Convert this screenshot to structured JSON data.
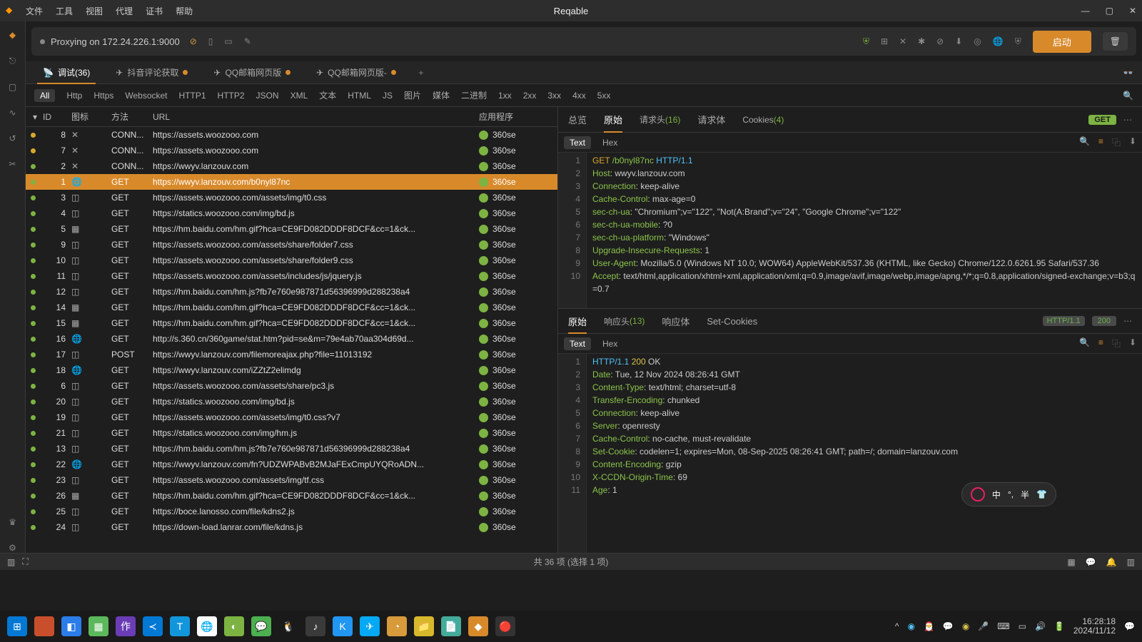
{
  "app": {
    "title": "Reqable"
  },
  "menu": [
    "文件",
    "工具",
    "视图",
    "代理",
    "证书",
    "帮助"
  ],
  "toolbar": {
    "proxying": "Proxying on 172.24.226.1:9000",
    "launch": "启动"
  },
  "capture_tabs": [
    {
      "icon": "antenna",
      "label": "调试(36)",
      "active": true
    },
    {
      "icon": "send",
      "label": "抖音评论获取",
      "modified": true
    },
    {
      "icon": "send",
      "label": "QQ邮箱网页版",
      "modified": true
    },
    {
      "icon": "send",
      "label": "QQ邮箱网页版-",
      "modified": true
    }
  ],
  "filters": [
    "All",
    "Http",
    "Https",
    "Websocket",
    "HTTP1",
    "HTTP2",
    "JSON",
    "XML",
    "文本",
    "HTML",
    "JS",
    "图片",
    "媒体",
    "二进制",
    "1xx",
    "2xx",
    "3xx",
    "4xx",
    "5xx"
  ],
  "columns": {
    "id": "ID",
    "icon": "图标",
    "method": "方法",
    "url": "URL",
    "app": "应用程序"
  },
  "rows": [
    {
      "s": "y",
      "id": 8,
      "i": "x",
      "m": "CONN...",
      "u": "https://assets.woozooo.com",
      "a": "360se"
    },
    {
      "s": "y",
      "id": 7,
      "i": "x",
      "m": "CONN...",
      "u": "https://assets.woozooo.com",
      "a": "360se"
    },
    {
      "s": "g",
      "id": 2,
      "i": "x",
      "m": "CONN...",
      "u": "https://wwyv.lanzouv.com",
      "a": "360se"
    },
    {
      "s": "g",
      "id": 1,
      "i": "globe",
      "m": "GET",
      "u": "https://wwyv.lanzouv.com/b0nyl87nc",
      "a": "360se",
      "sel": true
    },
    {
      "s": "g",
      "id": 3,
      "i": "file",
      "m": "GET",
      "u": "https://assets.woozooo.com/assets/img/t0.css",
      "a": "360se"
    },
    {
      "s": "g",
      "id": 4,
      "i": "file",
      "m": "GET",
      "u": "https://statics.woozooo.com/img/bd.js",
      "a": "360se"
    },
    {
      "s": "g",
      "id": 5,
      "i": "img",
      "m": "GET",
      "u": "https://hm.baidu.com/hm.gif?hca=CE9FD082DDDF8DCF&cc=1&ck...",
      "a": "360se"
    },
    {
      "s": "g",
      "id": 9,
      "i": "file",
      "m": "GET",
      "u": "https://assets.woozooo.com/assets/share/folder7.css",
      "a": "360se"
    },
    {
      "s": "g",
      "id": 10,
      "i": "file",
      "m": "GET",
      "u": "https://assets.woozooo.com/assets/share/folder9.css",
      "a": "360se"
    },
    {
      "s": "g",
      "id": 11,
      "i": "file",
      "m": "GET",
      "u": "https://assets.woozooo.com/assets/includes/js/jquery.js",
      "a": "360se"
    },
    {
      "s": "g",
      "id": 12,
      "i": "file",
      "m": "GET",
      "u": "https://hm.baidu.com/hm.js?fb7e760e987871d56396999d288238a4",
      "a": "360se"
    },
    {
      "s": "g",
      "id": 14,
      "i": "img",
      "m": "GET",
      "u": "https://hm.baidu.com/hm.gif?hca=CE9FD082DDDF8DCF&cc=1&ck...",
      "a": "360se"
    },
    {
      "s": "g",
      "id": 15,
      "i": "img",
      "m": "GET",
      "u": "https://hm.baidu.com/hm.gif?hca=CE9FD082DDDF8DCF&cc=1&ck...",
      "a": "360se"
    },
    {
      "s": "g",
      "id": 16,
      "i": "globe",
      "m": "GET",
      "u": "http://s.360.cn/360game/stat.htm?pid=se&m=79e4ab70aa304d69d...",
      "a": "360se"
    },
    {
      "s": "g",
      "id": 17,
      "i": "file",
      "m": "POST",
      "u": "https://wwyv.lanzouv.com/filemoreajax.php?file=11013192",
      "a": "360se"
    },
    {
      "s": "g",
      "id": 18,
      "i": "globe",
      "m": "GET",
      "u": "https://wwyv.lanzouv.com/iZZtZ2elimdg",
      "a": "360se"
    },
    {
      "s": "g",
      "id": 6,
      "i": "file",
      "m": "GET",
      "u": "https://assets.woozooo.com/assets/share/pc3.js",
      "a": "360se"
    },
    {
      "s": "g",
      "id": 20,
      "i": "file",
      "m": "GET",
      "u": "https://statics.woozooo.com/img/bd.js",
      "a": "360se"
    },
    {
      "s": "g",
      "id": 19,
      "i": "file",
      "m": "GET",
      "u": "https://assets.woozooo.com/assets/img/t0.css?v7",
      "a": "360se"
    },
    {
      "s": "g",
      "id": 21,
      "i": "file",
      "m": "GET",
      "u": "https://statics.woozooo.com/img/hm.js",
      "a": "360se"
    },
    {
      "s": "g",
      "id": 13,
      "i": "file",
      "m": "GET",
      "u": "https://hm.baidu.com/hm.js?fb7e760e987871d56396999d288238a4",
      "a": "360se"
    },
    {
      "s": "g",
      "id": 22,
      "i": "globe",
      "m": "GET",
      "u": "https://wwyv.lanzouv.com/fn?UDZWPABvB2MJaFExCmpUYQRoADN...",
      "a": "360se"
    },
    {
      "s": "g",
      "id": 23,
      "i": "file",
      "m": "GET",
      "u": "https://assets.woozooo.com/assets/img/tf.css",
      "a": "360se"
    },
    {
      "s": "g",
      "id": 26,
      "i": "img",
      "m": "GET",
      "u": "https://hm.baidu.com/hm.gif?hca=CE9FD082DDDF8DCF&cc=1&ck...",
      "a": "360se"
    },
    {
      "s": "g",
      "id": 25,
      "i": "file",
      "m": "GET",
      "u": "https://boce.lanosso.com/file/kdns2.js",
      "a": "360se"
    },
    {
      "s": "g",
      "id": 24,
      "i": "file",
      "m": "GET",
      "u": "https://down-load.lanrar.com/file/kdns.js",
      "a": "360se"
    }
  ],
  "detail": {
    "tabs": {
      "overview": "总览",
      "raw": "原始",
      "req_headers": "请求头",
      "req_hc": "(16)",
      "req_body": "请求体",
      "cookies": "Cookies",
      "cookies_c": "(4)"
    },
    "method_badge": "GET",
    "subtabs": {
      "text": "Text",
      "hex": "Hex"
    },
    "req_lines": [
      [
        {
          "t": "GET ",
          "c": "orange"
        },
        {
          "t": "/b0nyl87nc ",
          "c": "green"
        },
        {
          "t": "HTTP/1.1",
          "c": "blue"
        }
      ],
      [
        {
          "t": "Host",
          "c": "green"
        },
        {
          "t": ": wwyv.lanzouv.com",
          "c": ""
        }
      ],
      [
        {
          "t": "Connection",
          "c": "green"
        },
        {
          "t": ": keep-alive",
          "c": ""
        }
      ],
      [
        {
          "t": "Cache-Control",
          "c": "green"
        },
        {
          "t": ": max-age=0",
          "c": ""
        }
      ],
      [
        {
          "t": "sec-ch-ua",
          "c": "green"
        },
        {
          "t": ": \"Chromium\";v=\"122\", \"Not(A:Brand\";v=\"24\", \"Google Chrome\";v=\"122\"",
          "c": ""
        }
      ],
      [
        {
          "t": "sec-ch-ua-mobile",
          "c": "green"
        },
        {
          "t": ": ?0",
          "c": ""
        }
      ],
      [
        {
          "t": "sec-ch-ua-platform",
          "c": "green"
        },
        {
          "t": ": \"Windows\"",
          "c": ""
        }
      ],
      [
        {
          "t": "Upgrade-Insecure-Requests",
          "c": "green"
        },
        {
          "t": ": 1",
          "c": ""
        }
      ],
      [
        {
          "t": "User-Agent",
          "c": "green"
        },
        {
          "t": ": Mozilla/5.0 (Windows NT 10.0; WOW64) AppleWebKit/537.36 (KHTML, like Gecko) Chrome/122.0.6261.95 Safari/537.36",
          "c": ""
        }
      ],
      [
        {
          "t": "Accept",
          "c": "green"
        },
        {
          "t": ": text/html,application/xhtml+xml,application/xml;q=0.9,image/avif,image/webp,image/apng,*/*;q=0.8,application/signed-exchange;v=b3;q=0.7",
          "c": ""
        }
      ]
    ],
    "resp_tabs": {
      "raw": "原始",
      "resp_headers": "响应头",
      "resp_hc": "(13)",
      "resp_body": "响应体",
      "set_cookies": "Set-Cookies"
    },
    "resp_badges": {
      "proto": "HTTP/1.1",
      "status": "200"
    },
    "resp_lines": [
      [
        {
          "t": "HTTP/1.1 ",
          "c": "blue"
        },
        {
          "t": "200 ",
          "c": "yellow"
        },
        {
          "t": "OK",
          "c": ""
        }
      ],
      [
        {
          "t": "Date",
          "c": "green"
        },
        {
          "t": ": Tue, 12 Nov 2024 08:26:41 GMT",
          "c": ""
        }
      ],
      [
        {
          "t": "Content-Type",
          "c": "green"
        },
        {
          "t": ": text/html; charset=utf-8",
          "c": ""
        }
      ],
      [
        {
          "t": "Transfer-Encoding",
          "c": "green"
        },
        {
          "t": ": chunked",
          "c": ""
        }
      ],
      [
        {
          "t": "Connection",
          "c": "green"
        },
        {
          "t": ": keep-alive",
          "c": ""
        }
      ],
      [
        {
          "t": "Server",
          "c": "green"
        },
        {
          "t": ": openresty",
          "c": ""
        }
      ],
      [
        {
          "t": "Cache-Control",
          "c": "green"
        },
        {
          "t": ": no-cache, must-revalidate",
          "c": ""
        }
      ],
      [
        {
          "t": "Set-Cookie",
          "c": "green"
        },
        {
          "t": ": codelen=1; expires=Mon, 08-Sep-2025 08:26:41 GMT; path=/; domain=lanzouv.com",
          "c": ""
        }
      ],
      [
        {
          "t": "Content-Encoding",
          "c": "green"
        },
        {
          "t": ": gzip",
          "c": ""
        }
      ],
      [
        {
          "t": "X-CCDN-Origin-Time",
          "c": "green"
        },
        {
          "t": ": 69",
          "c": ""
        }
      ],
      [
        {
          "t": "Age",
          "c": "green"
        },
        {
          "t": ": 1",
          "c": ""
        }
      ]
    ]
  },
  "statusbar": {
    "center": "共 36 项 (选择 1 项)"
  },
  "clock": {
    "time": "16:28:18",
    "date": "2024/11/12"
  },
  "ime": {
    "lang": "中",
    "punct": "°,",
    "width": "半",
    "shirt": "👕"
  }
}
